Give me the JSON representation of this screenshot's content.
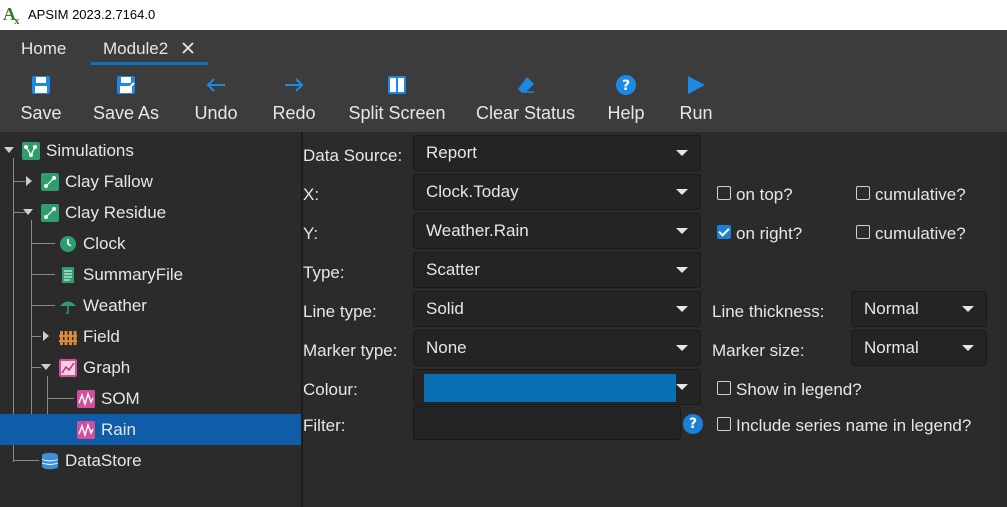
{
  "window": {
    "title": "APSIM 2023.2.7164.0"
  },
  "tabs": [
    {
      "label": "Home"
    },
    {
      "label": "Module2",
      "close_icon": "close-icon"
    }
  ],
  "toolbar": {
    "save": "Save",
    "save_as": "Save As",
    "undo": "Undo",
    "redo": "Redo",
    "split_screen": "Split Screen",
    "clear_status": "Clear Status",
    "help": "Help",
    "run": "Run"
  },
  "tree": {
    "simulations": "Simulations",
    "clay_fallow": "Clay Fallow",
    "clay_residue": "Clay Residue",
    "clock": "Clock",
    "summary_file": "SummaryFile",
    "weather": "Weather",
    "field": "Field",
    "graph": "Graph",
    "som": "SOM",
    "rain": "Rain",
    "datastore": "DataStore",
    "selected": "Rain"
  },
  "form": {
    "data_source_label": "Data Source:",
    "data_source_value": "Report",
    "x_label": "X:",
    "x_value": "Clock.Today",
    "y_label": "Y:",
    "y_value": "Weather.Rain",
    "type_label": "Type:",
    "type_value": "Scatter",
    "line_type_label": "Line type:",
    "line_type_value": "Solid",
    "marker_type_label": "Marker type:",
    "marker_type_value": "None",
    "colour_label": "Colour:",
    "colour_value": "#0a6eb4",
    "filter_label": "Filter:",
    "filter_value": "",
    "line_thickness_label": "Line thickness:",
    "line_thickness_value": "Normal",
    "marker_size_label": "Marker size:",
    "marker_size_value": "Normal",
    "x_on_top_label": "on top?",
    "x_on_top_checked": false,
    "x_cumulative_label": "cumulative?",
    "x_cumulative_checked": false,
    "y_on_right_label": "on right?",
    "y_on_right_checked": true,
    "y_cumulative_label": "cumulative?",
    "y_cumulative_checked": false,
    "show_in_legend_label": "Show in legend?",
    "show_in_legend_checked": false,
    "include_series_name_label": "Include series name in legend?",
    "include_series_name_checked": false,
    "filter_help": "?"
  },
  "colors": {
    "accent": "#0a74c4",
    "selection": "#0f5da8",
    "tree_icon_green": "#2e9e6e",
    "graph_icon_pink": "#d24f9e",
    "datastore_blue": "#3d8fd9"
  }
}
